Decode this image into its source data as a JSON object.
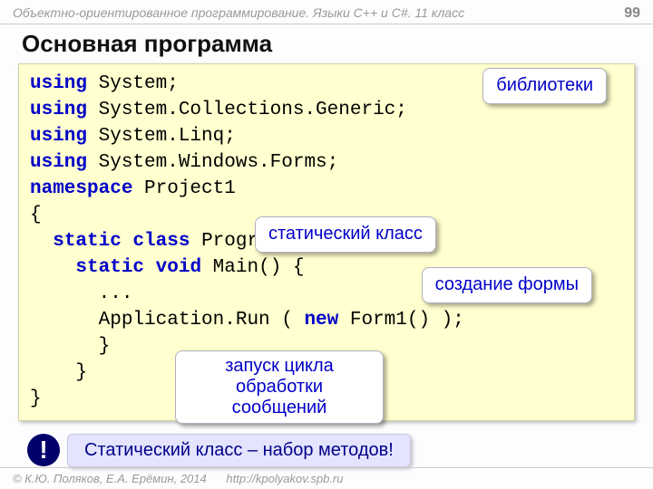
{
  "header": {
    "course": "Объектно-ориентированное программирование. Языки C++ и C#. 11 класс",
    "page": "99"
  },
  "title": "Основная программа",
  "code": {
    "l1_kw": "using",
    "l1_rest": " System;",
    "l2_kw": "using",
    "l2_rest": " System.Collections.Generic;",
    "l3_kw": "using",
    "l3_rest": " System.Linq;",
    "l4_kw": "using",
    "l4_rest": " System.Windows.Forms;",
    "l5_kw": "namespace",
    "l5_rest": " Project1",
    "l6": "{",
    "l7_pre": "  ",
    "l7_static": "static",
    "l7_sp1": " ",
    "l7_class": "class",
    "l7_rest": " Program  {",
    "l8_pre": "    ",
    "l8_static": "static",
    "l8_sp1": " ",
    "l8_void": "void",
    "l8_rest": " Main() {",
    "l9": "      ...",
    "l10_pre": "      Application.Run ( ",
    "l10_new": "new",
    "l10_rest": " Form1() );",
    "l11": "      }",
    "l12": "    }",
    "l13": "}"
  },
  "callouts": {
    "libs": "библиотеки",
    "static_class": "статический класс",
    "create_form": "создание формы",
    "loop": "запуск цикла\nобработки сообщений"
  },
  "note": {
    "bang": "!",
    "text": "Статический класс – набор методов!"
  },
  "footer": {
    "copyright": "© К.Ю. Поляков, Е.А. Ерёмин, 2014",
    "url": "http://kpolyakov.spb.ru"
  }
}
